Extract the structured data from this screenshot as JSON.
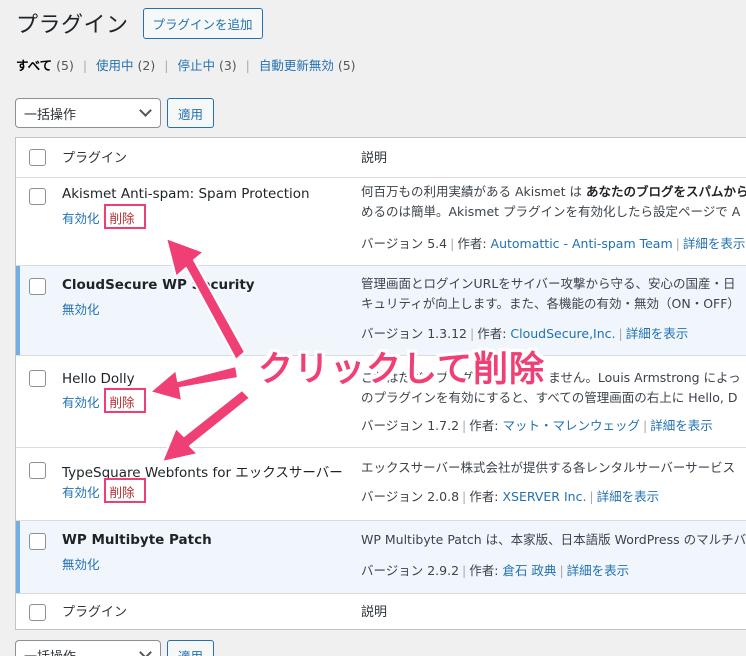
{
  "header": {
    "title": "プラグイン",
    "add_button": "プラグインを追加"
  },
  "filters": {
    "all_label": "すべて",
    "all_count": "(5)",
    "active_label": "使用中",
    "active_count": "(2)",
    "inactive_label": "停止中",
    "inactive_count": "(3)",
    "auto_update_label": "自動更新無効",
    "auto_update_count": "(5)",
    "separator": "|"
  },
  "bulk": {
    "select_value": "一括操作",
    "apply_label": "適用"
  },
  "table": {
    "col_plugin": "プラグイン",
    "col_description": "説明"
  },
  "plugins": [
    {
      "name": "Akismet Anti-spam: Spam Protection",
      "action": "有効化",
      "delete": "削除",
      "desc_line1_a": "何百万もの利用実績がある Akismet は",
      "desc_line1_b": "あなたのブログをスパムから",
      "desc_line2": "めるのは簡単。Akismet プラグインを有効化したら設定ページで A",
      "version": "バージョン 5.4",
      "author_label": "作者:",
      "author": "Automattic - Anti-spam Team",
      "details": "詳細を表示"
    },
    {
      "name": "CloudSecure WP Security",
      "action": "無効化",
      "desc_line1": "管理画面とログインURLをサイバー攻撃から守る、安心の国産・日",
      "desc_line2": "キュリティが向上します。また、各機能の有効・無効（ON・OFF）",
      "version": "バージョン 1.3.12",
      "author_label": "作者:",
      "author": "CloudSecure,Inc.",
      "details": "詳細を表示"
    },
    {
      "name": "Hello Dolly",
      "action": "有効化",
      "delete": "削除",
      "desc_line1": "これはただのプラグインではありません。Louis Armstrong によっ",
      "desc_line2": "のプラグインを有効にすると、すべての管理画面の右上に Hello, D",
      "version": "バージョン 1.7.2",
      "author_label": "作者:",
      "author": "マット・マレンウェッグ",
      "details": "詳細を表示"
    },
    {
      "name": "TypeSquare Webfonts for エックスサーバー",
      "action": "有効化",
      "delete": "削除",
      "desc_line1": "エックスサーバー株式会社が提供する各レンタルサーバーサービス",
      "version": "バージョン 2.0.8",
      "author_label": "作者:",
      "author": "XSERVER Inc.",
      "details": "詳細を表示"
    },
    {
      "name": "WP Multibyte Patch",
      "action": "無効化",
      "desc_line1": "WP Multibyte Patch は、本家版、日本語版 WordPress のマルチバ",
      "version": "バージョン 2.9.2",
      "author_label": "作者:",
      "author": "倉石 政典",
      "details": "詳細を表示"
    }
  ],
  "annotation": {
    "callout": "クリックして削除",
    "color": "#f03f74"
  }
}
